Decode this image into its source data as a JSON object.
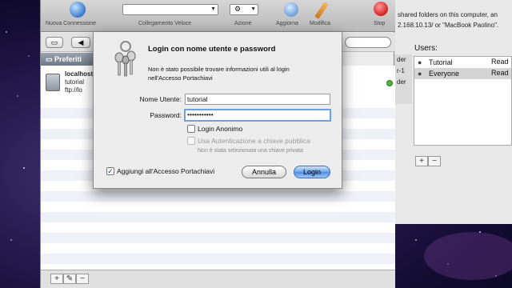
{
  "toolbar": {
    "new_connection_label": "Nuova Connessione",
    "quick_connect_label": "Collegamento Veloce",
    "actions_label": "Azione",
    "refresh_label": "Aggiorna",
    "edit_label": "Modifica",
    "stop_label": "Stop",
    "quick_connect_value": "",
    "actions_value": ""
  },
  "sidebar": {
    "favorites_label": "Preferiti"
  },
  "connection": {
    "title": "localhost",
    "user": "tutorial",
    "url": "ftp://lo"
  },
  "login_sheet": {
    "title": "Login con nome utente e password",
    "message": "Non è stato possibile trovare informazioni utili al login nell'Accesso Portachiavi",
    "username_label": "Nome Utente:",
    "username_value": "tutorial",
    "password_label": "Password:",
    "password_value": "•••••••••••",
    "anonymous_label": "Login Anonimo",
    "public_key_label": "Usa Autenticazione a chiave pubblica",
    "no_key_note": "Non è stata selezionata una chiave privata",
    "keychain_label": "Aggiungi all'Accesso Portachiavi",
    "keychain_checked": true,
    "cancel_label": "Annulla",
    "login_label": "Login"
  },
  "sharing_window": {
    "description_line1": "shared folders on this computer, an",
    "description_line2": "2.168.10.13/ or \"MacBook Paolino\".",
    "users_label": "Users:",
    "users": [
      {
        "name": "Tutorial",
        "permission": "Read"
      },
      {
        "name": "Everyone",
        "permission": "Read"
      }
    ],
    "strip_lines": [
      "der",
      "r-1",
      "der"
    ]
  },
  "colors": {
    "default_button": "#4d8de0",
    "focus_ring": "#6fa0e0",
    "status_online": "#4fb43a"
  }
}
